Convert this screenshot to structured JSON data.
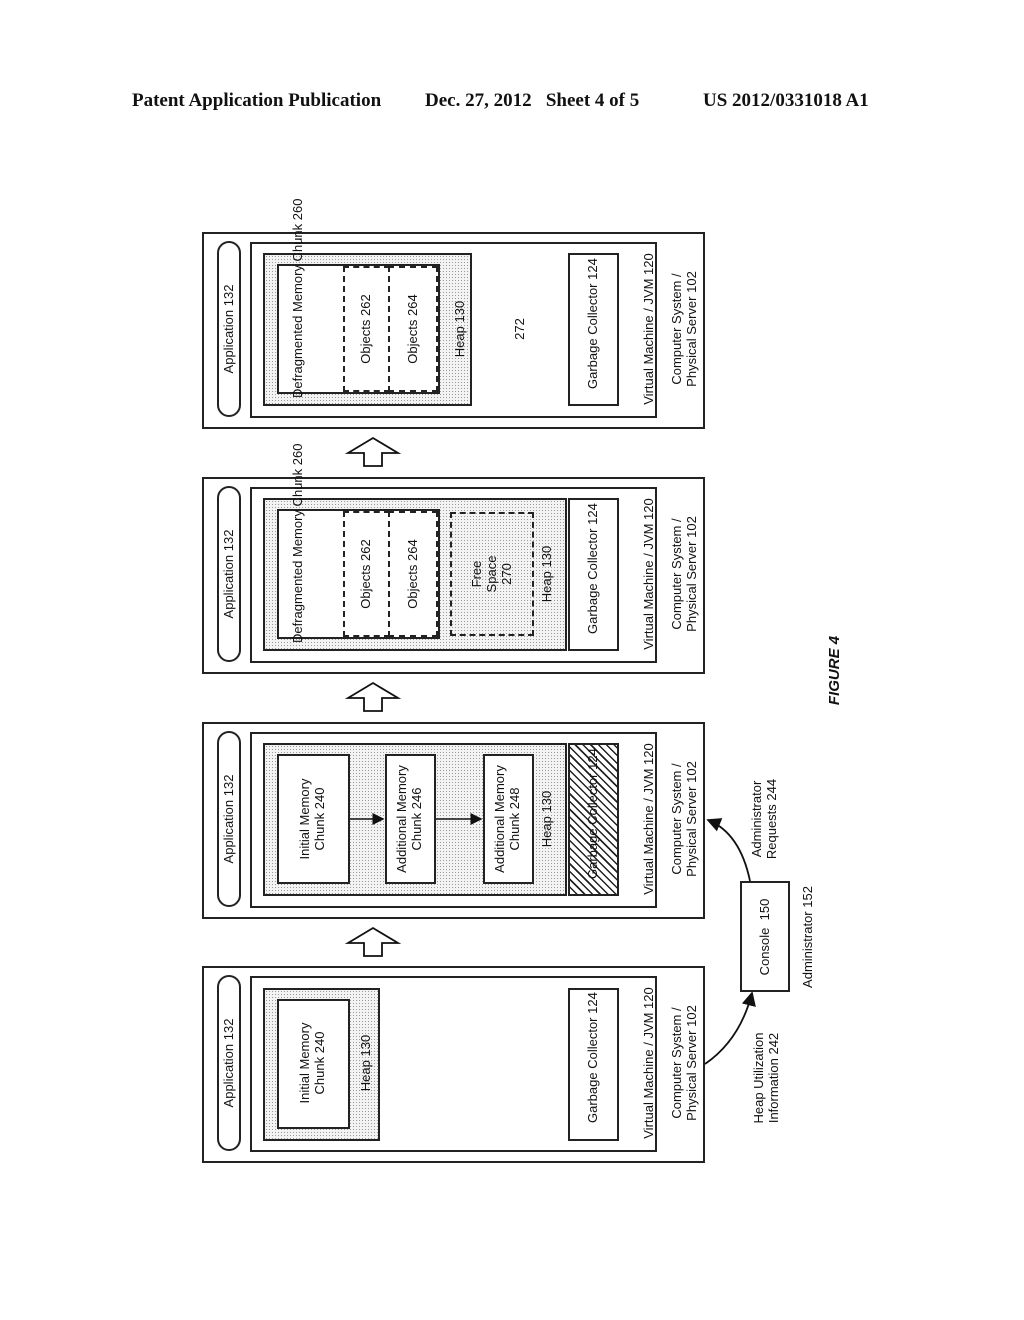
{
  "header": {
    "publication": "Patent Application Publication",
    "date_sheet": "Dec. 27, 2012   Sheet 4 of 5",
    "number": "US 2012/0331018 A1"
  },
  "figure_label": "FIGURE 4",
  "panels": [
    {
      "application": "Application 132",
      "memory_chunk": "Defragmented Memory Chunk 260",
      "objects_a": "Objects 262",
      "objects_b": "Objects 264",
      "heap": "Heap 130",
      "space_label": "272",
      "gc": "Garbage Collector 124",
      "vm": "Virtual Machine / JVM 120",
      "server_line1": "Computer System /",
      "server_line2": "Physical Server 102"
    },
    {
      "application": "Application 132",
      "memory_chunk": "Defragmented Memory Chunk 260",
      "objects_a": "Objects 262",
      "objects_b": "Objects 264",
      "free_space_line1": "Free",
      "free_space_line2": "Space",
      "free_space_line3": "270",
      "heap": "Heap 130",
      "gc": "Garbage Collector 124",
      "vm": "Virtual Machine / JVM 120",
      "server_line1": "Computer System /",
      "server_line2": "Physical Server 102"
    },
    {
      "application": "Application 132",
      "chunk1_line1": "Initial Memory",
      "chunk1_line2": "Chunk 240",
      "chunk2_line1": "Additional Memory",
      "chunk2_line2": "Chunk 246",
      "chunk3_line1": "Additional Memory",
      "chunk3_line2": "Chunk 248",
      "heap": "Heap 130",
      "gc": "Garbage Collector 124",
      "vm": "Virtual Machine / JVM 120",
      "server_line1": "Computer System /",
      "server_line2": "Physical Server 102"
    },
    {
      "application": "Application 132",
      "chunk1_line1": "Initial Memory",
      "chunk1_line2": "Chunk 240",
      "heap": "Heap 130",
      "gc": "Garbage Collector 124",
      "vm": "Virtual Machine / JVM 120",
      "server_line1": "Computer System /",
      "server_line2": "Physical Server 102"
    }
  ],
  "console": {
    "label": "Console  150",
    "admin": "Administrator 152",
    "heap_info_line1": "Heap Utilization",
    "heap_info_line2": "Information 242",
    "admin_req_line1": "Administrator",
    "admin_req_line2": "Requests 244"
  }
}
